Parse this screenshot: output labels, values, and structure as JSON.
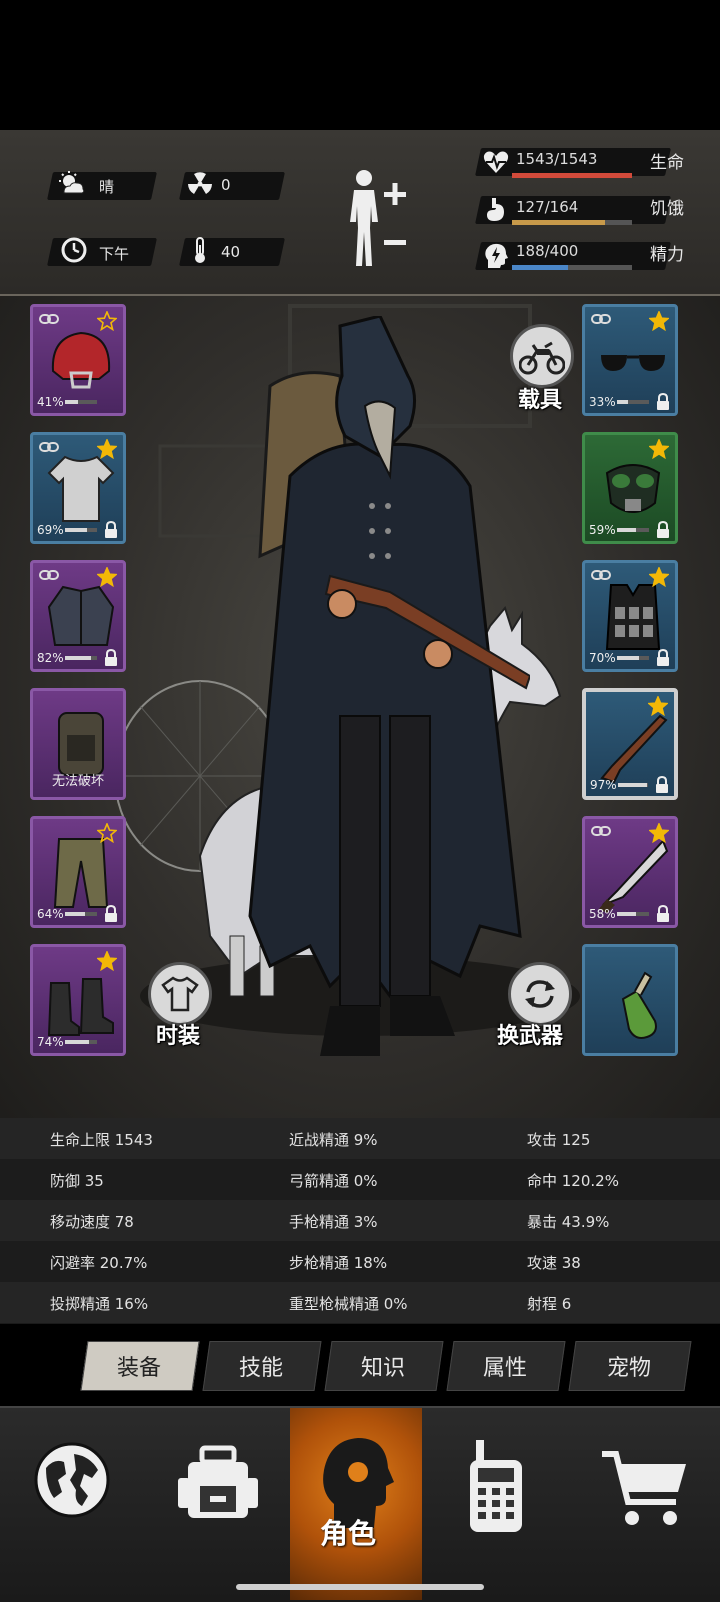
{
  "status": {
    "weather": {
      "icon": "partly-cloudy-icon",
      "label": "晴"
    },
    "radiation": {
      "icon": "radiation-icon",
      "value": "0"
    },
    "time_of_day": {
      "icon": "clock-icon",
      "label": "下午"
    },
    "temperature": {
      "icon": "thermometer-icon",
      "value": "40"
    },
    "body_icon": "body-figure-icon",
    "vitals": [
      {
        "icon": "heart-pulse-icon",
        "value": "1543/1543",
        "label": "生命",
        "fraction": 1.0,
        "color": "#d24a3a"
      },
      {
        "icon": "stomach-icon",
        "value": "127/164",
        "label": "饥饿",
        "fraction": 0.774,
        "color": "#c89a4a"
      },
      {
        "icon": "head-bolt-icon",
        "value": "188/400",
        "label": "精力",
        "fraction": 0.47,
        "color": "#4a86c8"
      }
    ]
  },
  "equipment": {
    "left_slots": [
      {
        "item": "helmet-icon",
        "pct": "41%",
        "durability": 0.41,
        "rarity": "purple",
        "star": "outline",
        "linked": true,
        "locked": false
      },
      {
        "item": "shirt-icon",
        "pct": "69%",
        "durability": 0.69,
        "rarity": "blue",
        "star": "filled",
        "linked": true,
        "locked": true
      },
      {
        "item": "jacket-icon",
        "pct": "82%",
        "durability": 0.82,
        "rarity": "purple",
        "star": "filled",
        "linked": true,
        "locked": true
      },
      {
        "item": "backpack-icon",
        "note": "无法破坏",
        "rarity": "purple",
        "star": "none",
        "linked": false,
        "locked": false
      },
      {
        "item": "pants-icon",
        "pct": "64%",
        "durability": 0.64,
        "rarity": "purple",
        "star": "outline",
        "linked": false,
        "locked": true
      },
      {
        "item": "boots-icon",
        "pct": "74%",
        "durability": 0.74,
        "rarity": "purple",
        "star": "filled",
        "linked": false,
        "locked": false
      }
    ],
    "right_slots": [
      {
        "item": "sunglasses-icon",
        "pct": "33%",
        "durability": 0.33,
        "rarity": "blue",
        "star": "filled",
        "linked": true,
        "locked": true
      },
      {
        "item": "gas-mask-icon",
        "pct": "59%",
        "durability": 0.59,
        "rarity": "green",
        "star": "filled",
        "linked": false,
        "locked": true
      },
      {
        "item": "tactical-vest-icon",
        "pct": "70%",
        "durability": 0.7,
        "rarity": "blue",
        "star": "filled",
        "linked": true,
        "locked": true
      },
      {
        "item": "rifle-icon",
        "pct": "97%",
        "durability": 0.97,
        "rarity": "blue",
        "star": "filled",
        "linked": false,
        "locked": true,
        "selected": true
      },
      {
        "item": "machete-icon",
        "pct": "58%",
        "durability": 0.58,
        "rarity": "purple",
        "star": "filled",
        "linked": true,
        "locked": true
      },
      {
        "item": "molotov-icon",
        "rarity": "blue",
        "star": "none",
        "linked": false,
        "locked": false
      }
    ],
    "vehicle_label": "载具",
    "fashion_label": "时装",
    "swap_weapon_label": "换武器"
  },
  "stats": [
    [
      "生命上限 1543",
      "近战精通 9%",
      "攻击 125"
    ],
    [
      "防御 35",
      "弓箭精通 0%",
      "命中 120.2%"
    ],
    [
      "移动速度 78",
      "手枪精通 3%",
      "暴击 43.9%"
    ],
    [
      "闪避率 20.7%",
      "步枪精通 18%",
      "攻速 38"
    ],
    [
      "投掷精通 16%",
      "重型枪械精通 0%",
      "射程 6"
    ]
  ],
  "tabs": [
    "装备",
    "技能",
    "知识",
    "属性",
    "宠物"
  ],
  "active_tab": "装备",
  "bottom_nav": {
    "items": [
      "globe-icon",
      "backpack-icon",
      "character-icon",
      "walkie-talkie-icon",
      "cart-icon"
    ],
    "character_label": "角色"
  }
}
